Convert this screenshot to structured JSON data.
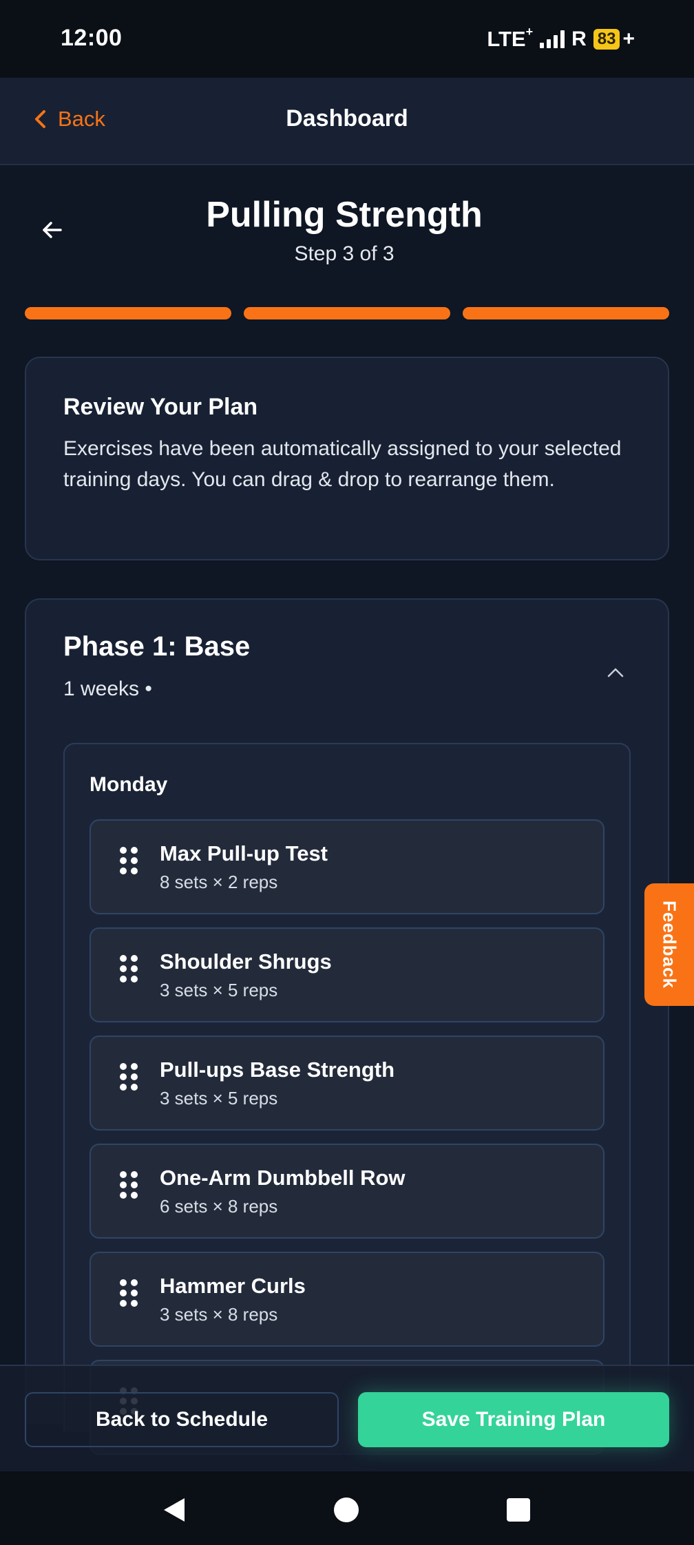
{
  "status_bar": {
    "time": "12:00",
    "network": "LTE",
    "network_sup": "+",
    "roaming": "R",
    "battery": "83",
    "charging": "+"
  },
  "navbar": {
    "back_label": "Back",
    "title": "Dashboard"
  },
  "header": {
    "title": "Pulling Strength",
    "step": "Step 3 of 3",
    "progress": {
      "current_step": 3,
      "total_steps": 3
    }
  },
  "review": {
    "title": "Review Your Plan",
    "body": "Exercises have been automatically assigned to your selected training days. You can drag & drop to rearrange them."
  },
  "phase": {
    "title": "Phase 1: Base",
    "subtitle": "1 weeks •",
    "day": "Monday",
    "exercises": [
      {
        "name": "Max Pull-up Test",
        "detail": "8 sets × 2 reps"
      },
      {
        "name": "Shoulder Shrugs",
        "detail": "3 sets × 5 reps"
      },
      {
        "name": "Pull-ups Base Strength",
        "detail": "3 sets × 5 reps"
      },
      {
        "name": "One-Arm Dumbbell Row",
        "detail": "6 sets × 8 reps"
      },
      {
        "name": "Hammer Curls",
        "detail": "3 sets × 8 reps"
      }
    ]
  },
  "feedback_label": "Feedback",
  "actions": {
    "secondary": "Back to Schedule",
    "primary": "Save Training Plan"
  },
  "colors": {
    "accent": "#f97316",
    "primary_button": "#34d399",
    "background": "#0f1624",
    "card": "#182133"
  },
  "icons": {
    "back": "chevron-left-icon",
    "header_back": "arrow-left-icon",
    "collapse": "chevron-up-icon",
    "drag": "drag-handle-icon",
    "sys_back": "triangle-back-icon",
    "sys_home": "circle-home-icon",
    "sys_recents": "square-recents-icon"
  }
}
